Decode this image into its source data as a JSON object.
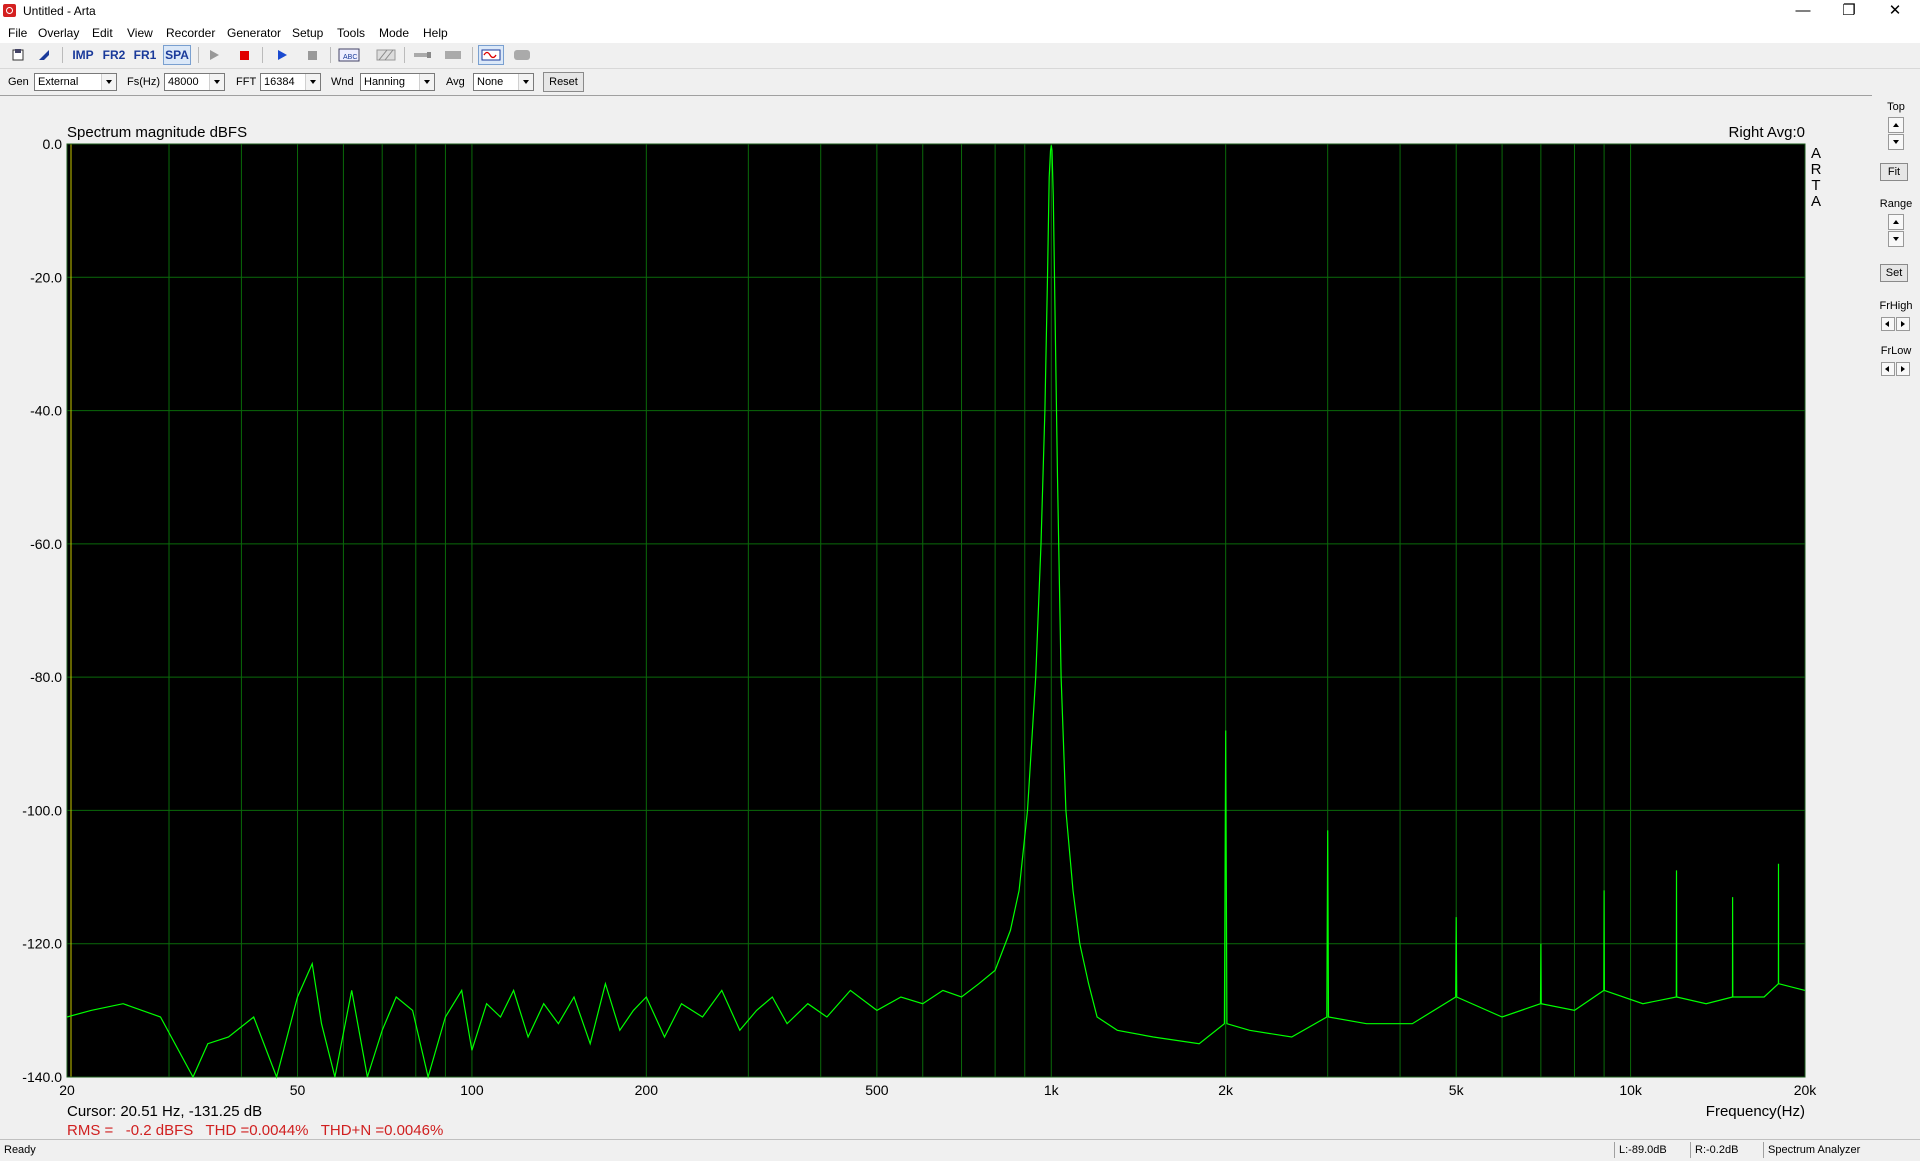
{
  "window": {
    "title": "Untitled - Arta",
    "minimize": "—",
    "maximize": "❐",
    "close": "✕"
  },
  "menu": [
    "File",
    "Overlay",
    "Edit",
    "View",
    "Recorder",
    "Generator",
    "Setup",
    "Tools",
    "Mode",
    "Help"
  ],
  "toolbar": {
    "imp": "IMP",
    "fr2": "FR2",
    "fr1": "FR1",
    "spa": "SPA"
  },
  "controls": {
    "gen_label": "Gen",
    "gen_value": "External",
    "fs_label": "Fs(Hz)",
    "fs_value": "48000",
    "fft_label": "FFT",
    "fft_value": "16384",
    "wnd_label": "Wnd",
    "wnd_value": "Hanning",
    "avg_label": "Avg",
    "avg_value": "None",
    "reset_label": "Reset"
  },
  "plot": {
    "title": "Spectrum magnitude dBFS",
    "channel_info": "Right  Avg:0",
    "arta_letters": [
      "A",
      "R",
      "T",
      "A"
    ],
    "cursor_text": "Cursor: 20.51 Hz, -131.25 dB",
    "measurements": "RMS =   -0.2 dBFS   THD =0.0044%   THD+N =0.0046%",
    "xlabel": "Frequency(Hz)",
    "colors": {
      "background": "#000000",
      "grid": "#0a6a0a",
      "trace": "#00ff00",
      "measure_text": "#d02020"
    }
  },
  "chart_data": {
    "type": "line",
    "title": "Spectrum magnitude dBFS",
    "xlabel": "Frequency(Hz)",
    "ylabel": "",
    "x_scale": "log",
    "xlim": [
      20,
      20000
    ],
    "ylim": [
      -140,
      0
    ],
    "grid": true,
    "x_ticks": [
      "20",
      "50",
      "100",
      "200",
      "500",
      "1k",
      "2k",
      "5k",
      "10k",
      "20k"
    ],
    "x_tick_values": [
      20,
      50,
      100,
      200,
      500,
      1000,
      2000,
      5000,
      10000,
      20000
    ],
    "y_ticks": [
      "0.0",
      "-20.0",
      "-40.0",
      "-60.0",
      "-80.0",
      "-100.0",
      "-120.0",
      "-140.0"
    ],
    "y_tick_values": [
      0,
      -20,
      -40,
      -60,
      -80,
      -100,
      -120,
      -140
    ],
    "series": [
      {
        "x": [
          20,
          22,
          25,
          29,
          33,
          35,
          38,
          42,
          46,
          50,
          53,
          55,
          58,
          62,
          66,
          70,
          74,
          79,
          84,
          90,
          96,
          100,
          106,
          112,
          118,
          125,
          133,
          141,
          150,
          160,
          170,
          180,
          190,
          200,
          215,
          230,
          250,
          270,
          290,
          310,
          330,
          350,
          380,
          410,
          450,
          500,
          550,
          600,
          650,
          700,
          750,
          800,
          850,
          880,
          910,
          940,
          960,
          975,
          985,
          992,
          997,
          1000,
          1003,
          1008,
          1015,
          1025,
          1040,
          1060,
          1090,
          1120,
          1160,
          1200,
          1300,
          1500,
          1800,
          1990,
          2000,
          2010,
          2200,
          2600,
          2990,
          3000,
          3010,
          3500,
          4200,
          4990,
          5000,
          5010,
          6000,
          6990,
          7000,
          7010,
          8000,
          8990,
          9000,
          9010,
          10500,
          11990,
          12000,
          12010,
          13500,
          14990,
          15000,
          15010,
          17000,
          17990,
          18000,
          18010,
          20000
        ],
        "y": [
          -131,
          -130,
          -129,
          -131,
          -140,
          -135,
          -134,
          -131,
          -140,
          -128,
          -123,
          -132,
          -140,
          -127,
          -140,
          -133,
          -128,
          -130,
          -140,
          -131,
          -127,
          -136,
          -129,
          -131,
          -127,
          -134,
          -129,
          -132,
          -128,
          -135,
          -126,
          -133,
          -130,
          -128,
          -134,
          -129,
          -131,
          -127,
          -133,
          -130,
          -128,
          -132,
          -129,
          -131,
          -127,
          -130,
          -128,
          -129,
          -127,
          -128,
          -126,
          -124,
          -118,
          -112,
          -100,
          -80,
          -60,
          -40,
          -20,
          -5,
          -1,
          -0.2,
          -1,
          -8,
          -25,
          -50,
          -80,
          -100,
          -112,
          -120,
          -126,
          -131,
          -133,
          -134,
          -135,
          -132,
          -88,
          -132,
          -133,
          -134,
          -131,
          -103,
          -131,
          -132,
          -132,
          -128,
          -116,
          -128,
          -131,
          -129,
          -120,
          -129,
          -130,
          -127,
          -112,
          -127,
          -129,
          -128,
          -109,
          -128,
          -129,
          -128,
          -113,
          -128,
          -128,
          -126,
          -108,
          -126,
          -127
        ]
      }
    ]
  },
  "side": {
    "top": "Top",
    "fit": "Fit",
    "range": "Range",
    "set": "Set",
    "frhigh": "FrHigh",
    "frlow": "FrLow"
  },
  "status": {
    "ready": "Ready",
    "l_level": "L:-89.0dB",
    "r_level": "R:-0.2dB",
    "mode": "Spectrum Analyzer"
  }
}
